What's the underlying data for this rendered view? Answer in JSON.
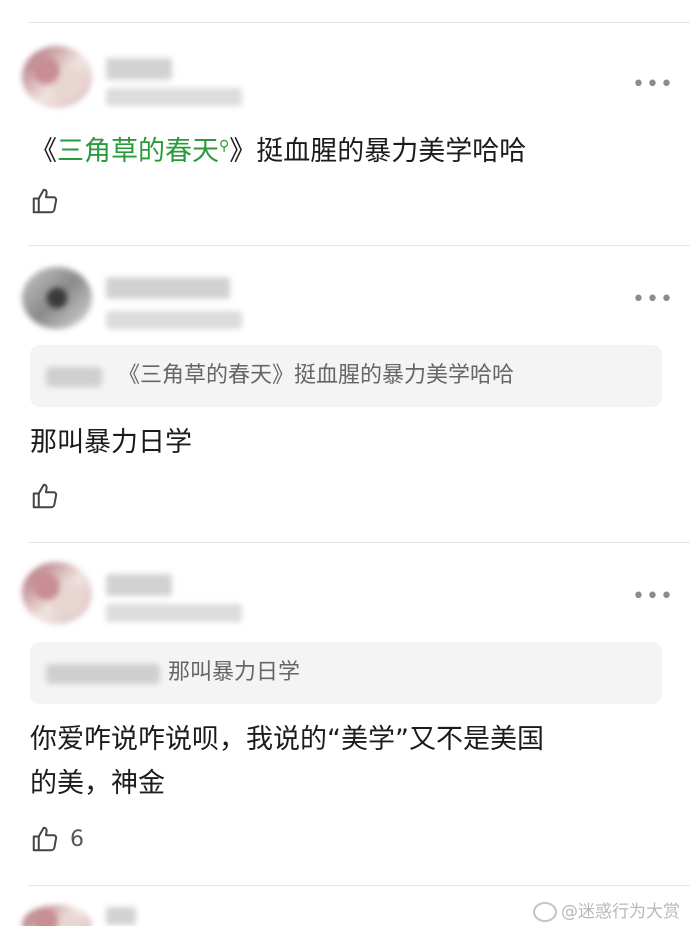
{
  "comments": [
    {
      "text_before": "《",
      "link": "三角草的春天",
      "text_after": "》挺血腥的暴力美学哈哈",
      "likes": ""
    },
    {
      "quote": "《三角草的春天》挺血腥的暴力美学哈哈",
      "text": "那叫暴力日学",
      "likes": ""
    },
    {
      "quote": "那叫暴力日学",
      "text_line1": "你爱咋说咋说呗，我说的“美学”又不是美国",
      "text_line2": "的美，神金",
      "likes": "6"
    }
  ],
  "more_label": "•••",
  "watermark": "@迷惑行为大赏",
  "icons": {
    "more": "more-dots-icon",
    "like": "thumbs-up-icon",
    "search": "search-icon",
    "weibo": "weibo-icon"
  }
}
